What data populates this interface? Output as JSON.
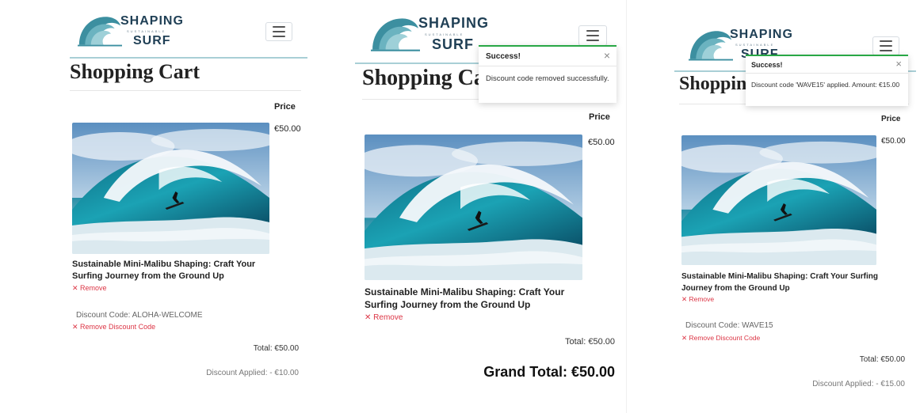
{
  "logo": {
    "word1": "SHAPING",
    "word2": "SUSTAINABLE",
    "word3": "SURF"
  },
  "colors": {
    "accent_rule": "#a9cfd6",
    "remove_red": "#dc3545",
    "toast_green": "#28a745",
    "logo_teal": "#3c8fa0"
  },
  "icons": {
    "menu": "hamburger-icon",
    "close": "close-icon",
    "remove": "x-icon"
  },
  "screen1": {
    "title": "Shopping Cart",
    "price_header": "Price",
    "item_price": "€50.00",
    "product_title": "Sustainable Mini-Malibu Shaping: Craft Your Surfing Journey from the Ground Up",
    "remove_label": "✕ Remove",
    "discount_code": "Discount Code: ALOHA-WELCOME",
    "remove_discount_label": "✕ Remove Discount Code",
    "total": "Total: €50.00",
    "discount_applied": "Discount Applied: - €10.00"
  },
  "screen2": {
    "title": "Shopping Cart",
    "price_header": "Price",
    "item_price": "€50.00",
    "product_title": "Sustainable Mini-Malibu Shaping: Craft Your Surfing Journey from the Ground Up",
    "remove_label": "✕ Remove",
    "total": "Total: €50.00",
    "grand_total": "Grand Total: €50.00",
    "toast": {
      "title": "Success!",
      "close": "×",
      "message": "Discount code removed successfully."
    }
  },
  "screen3": {
    "title": "Shopping Cart",
    "price_header": "Price",
    "item_price": "€50.00",
    "product_title": "Sustainable Mini-Malibu Shaping: Craft Your Surfing Journey from the Ground Up",
    "remove_label": "✕ Remove",
    "discount_code": "Discount Code: WAVE15",
    "remove_discount_label": "✕ Remove Discount Code",
    "total": "Total: €50.00",
    "discount_applied": "Discount Applied: - €15.00",
    "toast": {
      "title": "Success!",
      "close": "×",
      "message": "Discount code 'WAVE15' applied. Amount: €15.00"
    }
  }
}
